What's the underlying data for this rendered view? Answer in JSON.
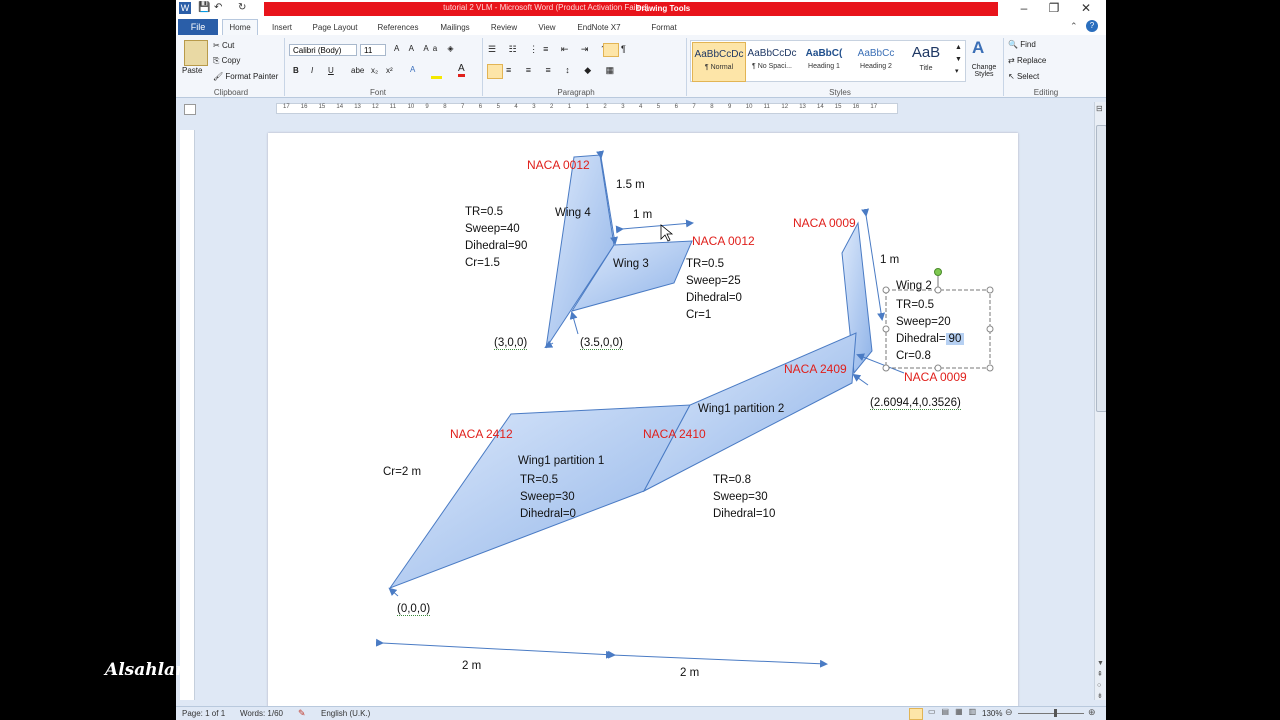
{
  "window": {
    "title": "tutorial 2 VLM  -  Microsoft Word (Product Activation Failed)",
    "context_tab": "Drawing Tools",
    "controls": {
      "minimize": "–",
      "restore": "❐",
      "close": "✕"
    }
  },
  "tabs": [
    "File",
    "Home",
    "Insert",
    "Page Layout",
    "References",
    "Mailings",
    "Review",
    "View",
    "EndNote X7",
    "Format"
  ],
  "ribbon": {
    "clipboard": {
      "paste": "Paste",
      "cut": "Cut",
      "copy": "Copy",
      "format_painter": "Format Painter",
      "label": "Clipboard"
    },
    "font": {
      "name": "Calibri (Body)",
      "size": "11",
      "label": "Font"
    },
    "paragraph": {
      "label": "Paragraph"
    },
    "styles": {
      "items": [
        {
          "preview": "AaBbCcDc",
          "name": "¶ Normal"
        },
        {
          "preview": "AaBbCcDc",
          "name": "¶ No Spaci..."
        },
        {
          "preview": "AaBbC(",
          "name": "Heading 1"
        },
        {
          "preview": "AaBbCc",
          "name": "Heading 2"
        },
        {
          "preview": "AaB",
          "name": "Title"
        }
      ],
      "change": "Change Styles",
      "label": "Styles"
    },
    "editing": {
      "find": "Find",
      "replace": "Replace",
      "select": "Select",
      "label": "Editing"
    }
  },
  "ruler": {
    "numbers": [
      "17",
      "16",
      "15",
      "14",
      "13",
      "12",
      "11",
      "10",
      "9",
      "8",
      "7",
      "6",
      "5",
      "4",
      "3",
      "2",
      "1",
      "1",
      "2",
      "3",
      "4",
      "5",
      "6",
      "7",
      "8",
      "9",
      "10",
      "11",
      "12",
      "13",
      "14",
      "15",
      "16",
      "17"
    ]
  },
  "drawing": {
    "wing4": {
      "naca_top": "NACA 0012",
      "label": "Wing 4",
      "dim": "1.5 m",
      "params": [
        "TR=0.5",
        "Sweep=40",
        "Dihedral=90",
        "Cr=1.5"
      ],
      "root": "(3,0,0)"
    },
    "wing3": {
      "naca_tip": "NACA 0012",
      "label": "Wing 3",
      "span": "1 m",
      "params": [
        "TR=0.5",
        "Sweep=25",
        "Dihedral=0",
        "Cr=1"
      ],
      "root": "(3.5,0,0)"
    },
    "wing2": {
      "naca_top": "NACA 0009",
      "naca_bottom": "NACA 0009",
      "label": "Wing 2",
      "span": "1 m",
      "params": [
        "TR=0.5",
        "Sweep=20",
        "Dihedral=",
        "Cr=0.8"
      ],
      "selected": "90",
      "root": "(2.6094,4,0.3526)"
    },
    "wing1p1": {
      "naca_root": "NACA 2412",
      "label": "Wing1 partition 1",
      "params": [
        "TR=0.5",
        "Sweep=30",
        "Dihedral=0"
      ],
      "cr": "Cr=2 m",
      "origin": "(0,0,0)",
      "span": "2 m"
    },
    "wing1p2": {
      "naca_root": "NACA 2410",
      "naca_tip": "NACA 2409",
      "label": "Wing1 partition 2",
      "params": [
        "TR=0.8",
        "Sweep=30",
        "Dihedral=10"
      ],
      "span": "2 m"
    }
  },
  "status": {
    "page": "Page: 1 of 1",
    "words": "Words: 1/60",
    "language": "English (U.K.)",
    "zoom": "130%"
  },
  "watermark": "Alsahlani",
  "colors": {
    "red_title": "#e8141b",
    "naca": "#e0201c",
    "wing_fill": "#a9c6ef",
    "wing_edge": "#4a7bc4"
  }
}
